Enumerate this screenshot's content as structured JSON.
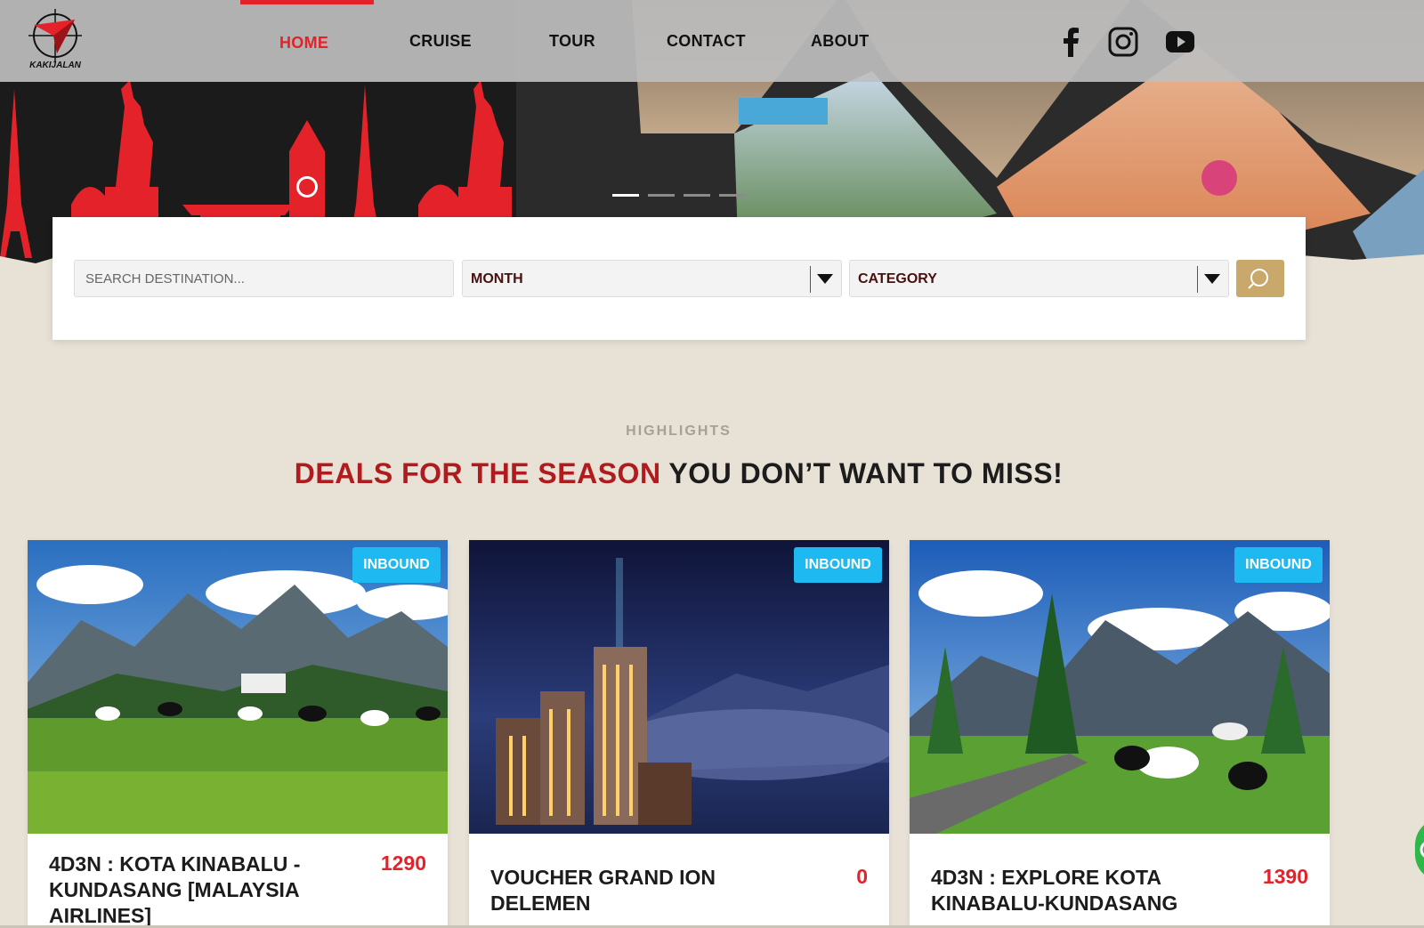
{
  "nav": {
    "logo_text": "KAKIJALAN",
    "items": [
      {
        "label": "HOME",
        "active": true
      },
      {
        "label": "CRUISE",
        "active": false
      },
      {
        "label": "TOUR",
        "active": false
      },
      {
        "label": "CONTACT",
        "active": false
      },
      {
        "label": "ABOUT",
        "active": false
      }
    ],
    "social_icons": [
      "facebook-icon",
      "instagram-icon",
      "youtube-icon"
    ],
    "accent_color": "#e42229"
  },
  "hero": {
    "slides_total": 4,
    "active_slide": 1
  },
  "search": {
    "destination_placeholder": "SEARCH DESTINATION...",
    "month_label": "MONTH",
    "category_label": "CATEGORY",
    "button_icon": "search-icon",
    "button_color": "#c8a86b"
  },
  "highlights": {
    "kicker": "HIGHLIGHTS",
    "headline_red": "DEALS FOR THE SEASON",
    "headline_rest": " YOU DON’T WANT TO MISS!"
  },
  "deals": [
    {
      "badge": "INBOUND",
      "title": "4D3N : KOTA KINABALU - KUNDASANG [MALAYSIA AIRLINES]",
      "price": "1290"
    },
    {
      "badge": "INBOUND",
      "title": "VOUCHER GRAND ION DELEMEN",
      "price": "0"
    },
    {
      "badge": "INBOUND",
      "title": "4D3N : EXPLORE KOTA KINABALU-KUNDASANG",
      "price": "1390"
    }
  ]
}
